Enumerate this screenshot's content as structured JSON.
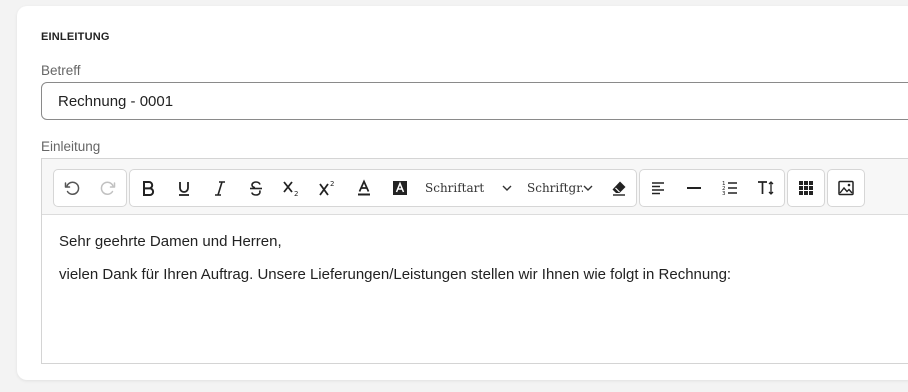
{
  "section": {
    "title": "EINLEITUNG"
  },
  "betreff": {
    "label": "Betreff",
    "value": "Rechnung - 0001"
  },
  "einleitung": {
    "label": "Einleitung",
    "toolbar": {
      "font_family_label": "Schriftart",
      "font_size_label": "Schriftgr..."
    },
    "content": {
      "line1": "Sehr geehrte Damen und Herren,",
      "line2": "vielen Dank für Ihren Auftrag. Unsere Lieferungen/Leistungen stellen wir Ihnen wie folgt in Rechnung:"
    }
  },
  "colors": {
    "card_bg": "#ffffff",
    "page_bg": "#f3f3f3",
    "toolbar_bg": "#f7f7f7"
  }
}
